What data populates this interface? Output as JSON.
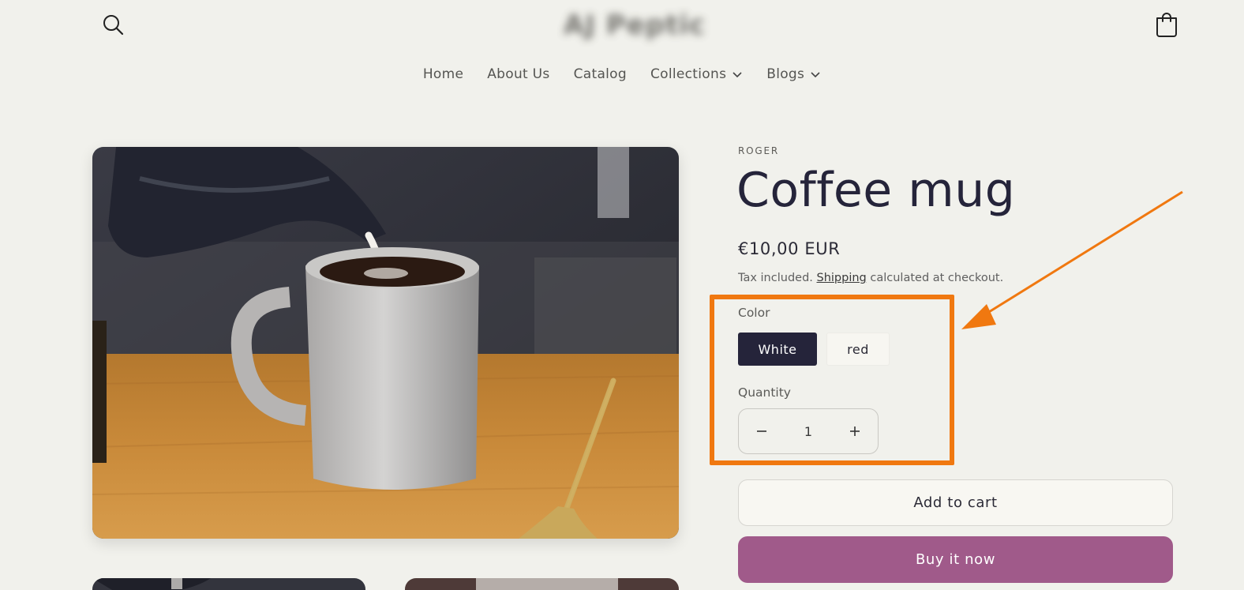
{
  "header": {
    "logo_text": "AJ Peptic",
    "icons": {
      "search": "search-icon",
      "cart": "cart-icon"
    }
  },
  "nav": {
    "items": [
      {
        "label": "Home",
        "has_dropdown": false
      },
      {
        "label": "About Us",
        "has_dropdown": false
      },
      {
        "label": "Catalog",
        "has_dropdown": false
      },
      {
        "label": "Collections",
        "has_dropdown": true
      },
      {
        "label": "Blogs",
        "has_dropdown": true
      }
    ]
  },
  "product": {
    "vendor": "ROGER",
    "title": "Coffee mug",
    "price": "€10,00 EUR",
    "tax_prefix": "Tax included.",
    "shipping_link": "Shipping",
    "tax_suffix": "calculated at checkout.",
    "color_label": "Color",
    "colors": [
      {
        "label": "White",
        "selected": true
      },
      {
        "label": "red",
        "selected": false
      }
    ],
    "quantity_label": "Quantity",
    "quantity": "1",
    "add_to_cart": "Add to cart",
    "buy_now": "Buy it now"
  },
  "colors": {
    "background": "#f1f1ec",
    "selected_swatch": "#25243a",
    "buy_now": "#a05a8a",
    "annotation": "#f07810"
  }
}
